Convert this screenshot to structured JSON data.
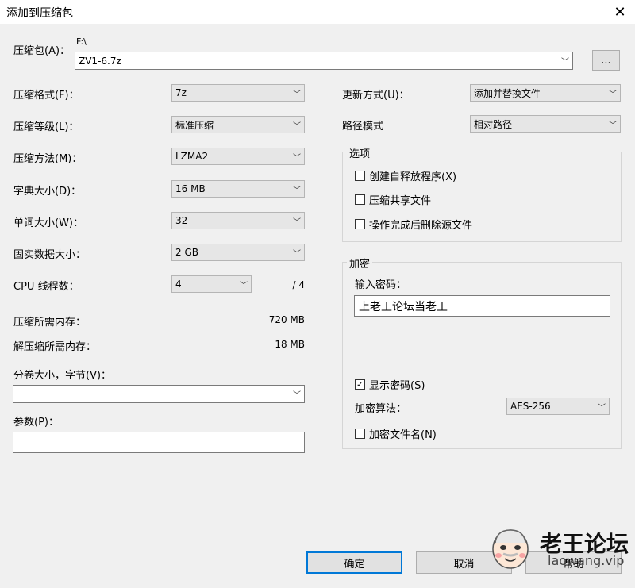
{
  "window": {
    "title": "添加到压缩包",
    "close_glyph": "✕"
  },
  "archive": {
    "label": "压缩包(A)：",
    "path": "F:\\",
    "value": "ZV1-6.7z",
    "browse_label": "..."
  },
  "left": {
    "format": {
      "label": "压缩格式(F)：",
      "value": "7z"
    },
    "level": {
      "label": "压缩等级(L)：",
      "value": "标准压缩"
    },
    "method": {
      "label": "压缩方法(M)：",
      "value": "LZMA2"
    },
    "dict": {
      "label": "字典大小(D)：",
      "value": "16 MB"
    },
    "word": {
      "label": "单词大小(W)：",
      "value": "32"
    },
    "solid": {
      "label": "固实数据大小：",
      "value": "2 GB"
    },
    "threads": {
      "label": "CPU 线程数：",
      "value": "4",
      "total": "/ 4"
    },
    "mem_comp": {
      "label": "压缩所需内存：",
      "value": "720 MB"
    },
    "mem_decomp": {
      "label": "解压缩所需内存：",
      "value": "18 MB"
    },
    "volume": {
      "label": "分卷大小，字节(V)：",
      "value": ""
    },
    "params": {
      "label": "参数(P)：",
      "value": ""
    }
  },
  "right": {
    "update": {
      "label": "更新方式(U)：",
      "value": "添加并替换文件"
    },
    "pathmode": {
      "label": "路径模式",
      "value": "相对路径"
    },
    "options": {
      "title": "选项",
      "items": [
        {
          "label": "创建自释放程序(X)",
          "checked": false
        },
        {
          "label": "压缩共享文件",
          "checked": false
        },
        {
          "label": "操作完成后删除源文件",
          "checked": false
        }
      ]
    },
    "encryption": {
      "title": "加密",
      "password_label": "输入密码：",
      "password_value": "上老王论坛当老王",
      "show_password": {
        "label": "显示密码(S)",
        "checked": true
      },
      "algo_label": "加密算法：",
      "algo_value": "AES-256",
      "encrypt_names": {
        "label": "加密文件名(N)",
        "checked": false
      }
    }
  },
  "buttons": {
    "ok": "确定",
    "cancel": "取消",
    "help": "帮助"
  },
  "watermark": {
    "title": "老王论坛",
    "url": "laowang.vip"
  },
  "colors": {
    "accent": "#0078d7",
    "background": "#f0f0f0"
  }
}
